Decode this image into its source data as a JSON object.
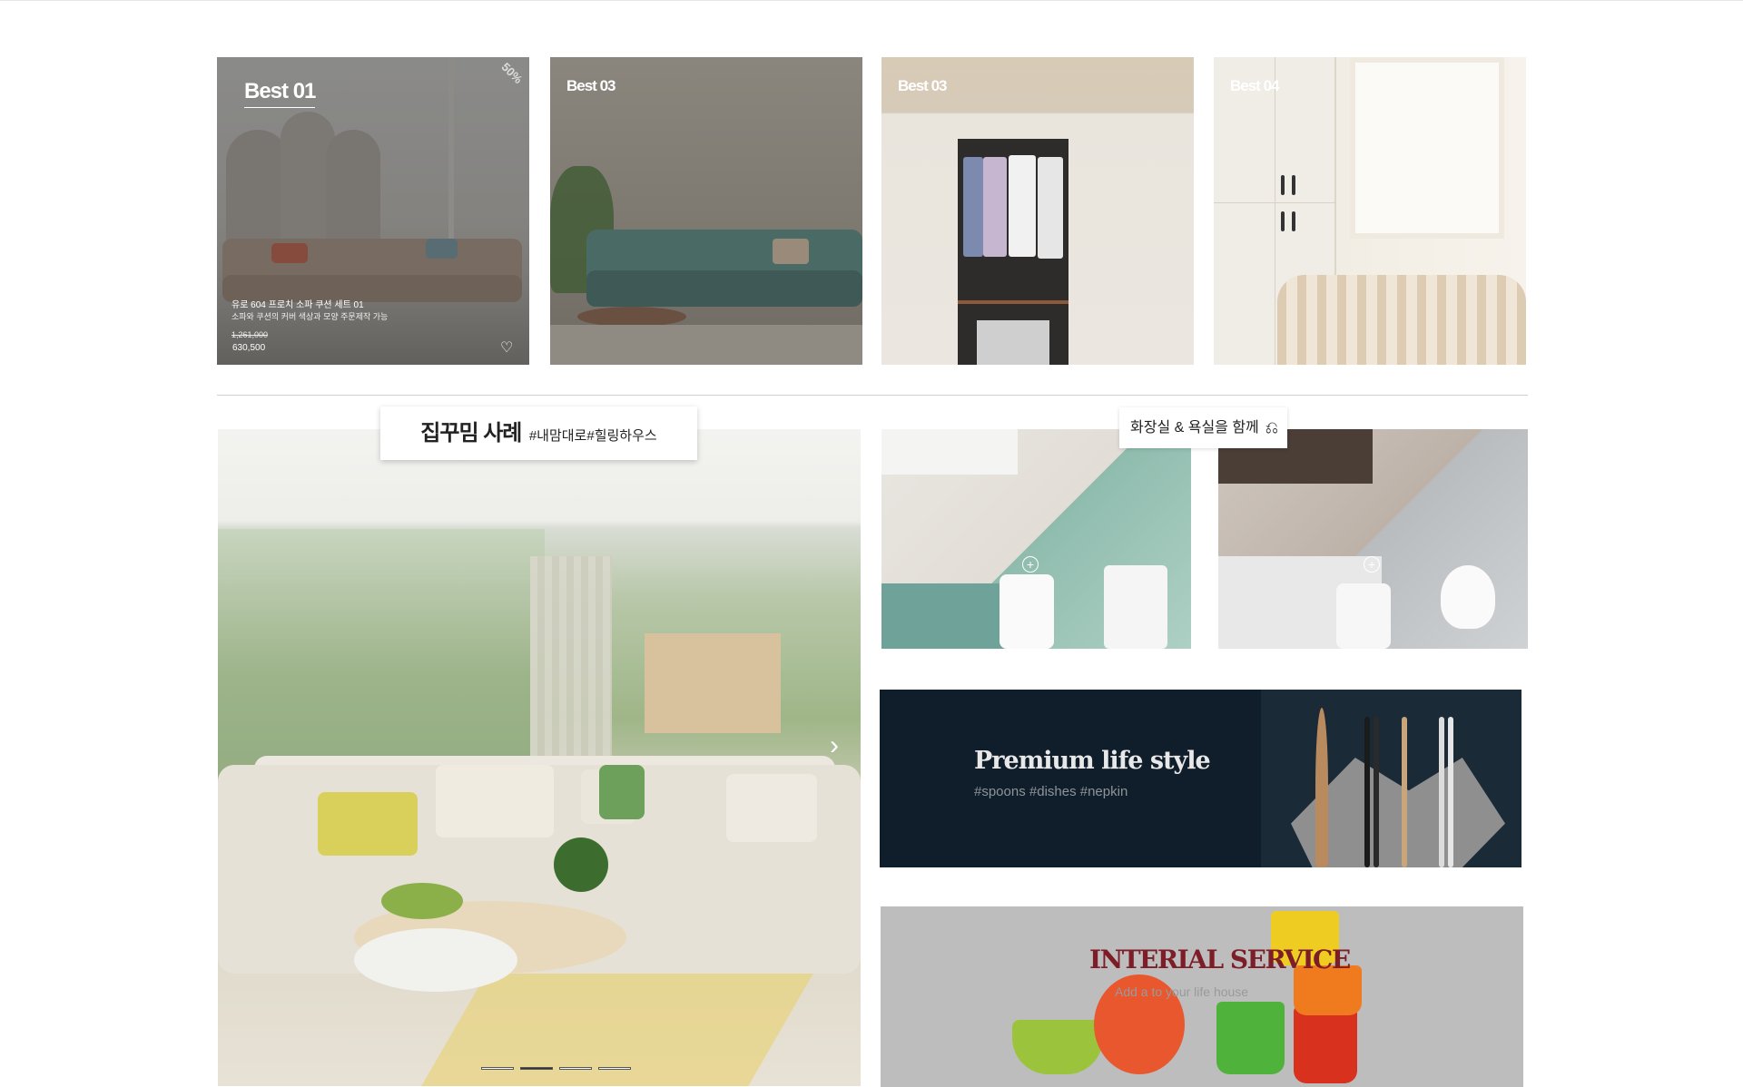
{
  "best_items": [
    {
      "label": "Best 01",
      "discount": "50%",
      "product_name": "유로 604 프로치 소파 쿠션 세트 01",
      "product_desc": "소파와 쿠션의 커버 색상과 모양 주문제작 가능",
      "price_old": "1,261,000",
      "price_new": "630,500",
      "icon": "heart-icon"
    },
    {
      "label": "Best 03"
    },
    {
      "label": "Best 03"
    },
    {
      "label": "Best 04"
    }
  ],
  "living_slider": {
    "title": "집꾸밈 사례",
    "tags": "#내맘대로#힐링하우스",
    "next_icon": "chevron-right-icon",
    "dots_count": 4,
    "active_dot": 2
  },
  "bath_kitchen": {
    "label": "화장실 & 욕실을 함께",
    "icon": "sink-icon"
  },
  "premium": {
    "title": "Premium life style",
    "tags": "#spoons #dishes #nepkin"
  },
  "interial": {
    "title": "INTERIAL SERVICE",
    "subtitle": "Add a to your life house"
  },
  "colors": {
    "interial_title": "#7c1d28",
    "premium_bg": "#0f1e2a"
  }
}
